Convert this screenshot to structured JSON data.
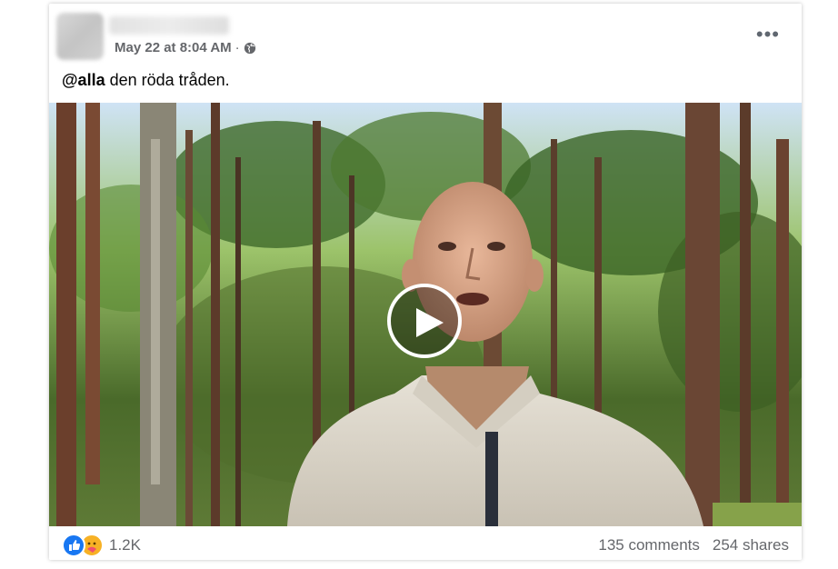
{
  "post": {
    "timestamp": "May 22 at 8:04 AM",
    "separator": "·",
    "caption_mention": "@alla",
    "caption_text": " den röda tråden.",
    "more_label": "•••"
  },
  "footer": {
    "reaction_count": "1.2K",
    "comments": "135 comments",
    "shares": "254 shares"
  },
  "icons": {
    "privacy": "globe-icon",
    "reactions": [
      "like-icon",
      "care-icon"
    ],
    "video": "play-icon"
  },
  "colors": {
    "secondary_text": "#65676b",
    "primary_text": "#050505",
    "like_blue": "#1877f2",
    "care_yellow": "#f7b125"
  }
}
